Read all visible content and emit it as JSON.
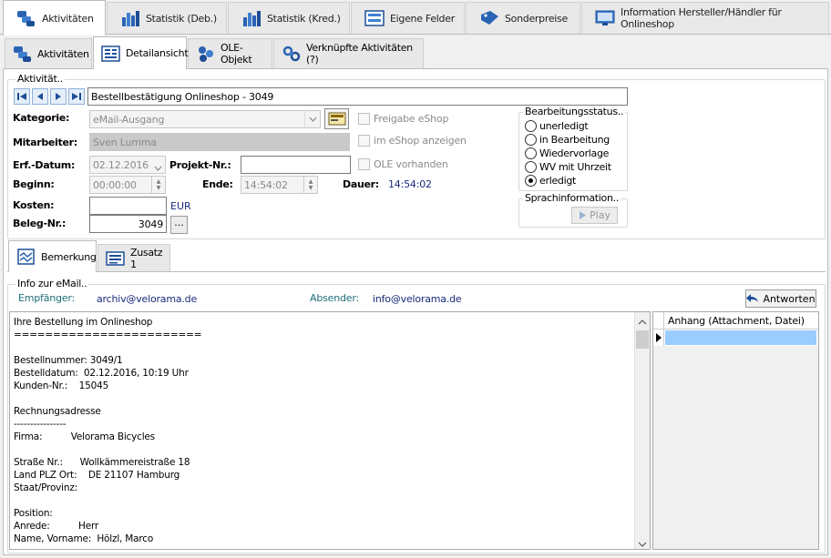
{
  "main_tabs": [
    {
      "label": "Aktivitäten",
      "icon": "activities-icon"
    },
    {
      "label": "Statistik (Deb.)",
      "icon": "bar-chart-icon"
    },
    {
      "label": "Statistik (Kred.)",
      "icon": "bar-chart-icon"
    },
    {
      "label": "Eigene Felder",
      "icon": "form-fields-icon"
    },
    {
      "label": "Sonderpreise",
      "icon": "price-tag-icon"
    },
    {
      "label": "Information Hersteller/Händler für Onlineshop",
      "icon": "monitor-info-icon"
    }
  ],
  "sub_tabs": [
    {
      "label": "Aktivitäten",
      "icon": "activities-icon"
    },
    {
      "label": "Detailansicht",
      "icon": "detail-view-icon"
    },
    {
      "label": "OLE-Objekt",
      "icon": "ole-object-icon"
    },
    {
      "label": "Verknüpfte Aktivitäten (?)",
      "icon": "link-icon"
    }
  ],
  "activity": {
    "group_label": "Aktivität..",
    "title": "Bestellbestätigung Onlineshop - 3049",
    "labels": {
      "kategorie": "Kategorie:",
      "mitarbeiter": "Mitarbeiter:",
      "erf_datum": "Erf.-Datum:",
      "projekt_nr": "Projekt-Nr.:",
      "beginn": "Beginn:",
      "ende": "Ende:",
      "dauer": "Dauer:",
      "kosten": "Kosten:",
      "beleg_nr": "Beleg-Nr.:"
    },
    "kategorie": "eMail-Ausgang",
    "mitarbeiter": "Sven Lumma",
    "erf_datum": "02.12.2016",
    "projekt_nr": "",
    "beginn": "00:00:00",
    "ende": "14:54:02",
    "dauer": "14:54:02",
    "kosten": "",
    "currency": "EUR",
    "beleg_nr": "3049",
    "beleg_button": "...",
    "checkboxes": {
      "freigabe": "Freigabe eShop",
      "im_eshop": "im eShop anzeigen",
      "ole": "OLE vorhanden"
    }
  },
  "status": {
    "group_label": "Bearbeitungsstatus..",
    "options": [
      "unerledigt",
      "in Bearbeitung",
      "Wiedervorlage",
      "WV mit Uhrzeit",
      "erledigt"
    ],
    "selected": "erledigt"
  },
  "sprach": {
    "group_label": "Sprachinformation..",
    "play": "Play"
  },
  "lower_tabs": [
    {
      "label": "Bemerkung",
      "icon": "note-icon"
    },
    {
      "label": "Zusatz 1",
      "icon": "list-icon"
    }
  ],
  "email": {
    "group_label": "Info zur eMail..",
    "empfaenger_label": "Empfänger:",
    "empfaenger": "archiv@velorama.de",
    "absender_label": "Absender:",
    "absender": "info@velorama.de",
    "reply_button": "Antworten",
    "body": "Ihre Bestellung im Onlineshop\n========================\n\nBestellnummer: 3049/1\nBestelldatum:  02.12.2016, 10:19 Uhr\nKunden-Nr.:    15045\n\nRechnungsadresse\n----------------\nFirma:          Velorama Bicycles\n\nStraße Nr.:      Wollkämmereistraße 18\nLand PLZ Ort:    DE 21107 Hamburg\nStaat/Provinz:\n\nPosition:\nAnrede:          Herr\nName, Vorname:  Hölzl, Marco",
    "attachment_header": "Anhang (Attachment, Datei)"
  },
  "colors": {
    "accent_blue": "#1a2a7a",
    "teal_label": "#1f6f7a",
    "selection": "#99ccff"
  }
}
